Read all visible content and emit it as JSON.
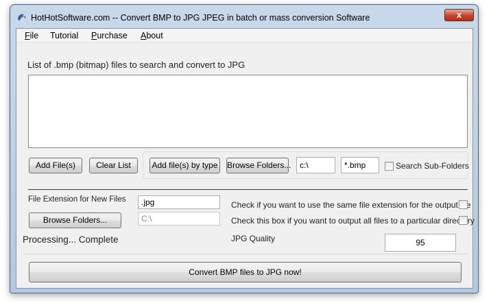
{
  "window": {
    "title": "HotHotSoftware.com -- Convert BMP to JPG JPEG in batch or mass conversion Software",
    "close_glyph": "x",
    "icon": "hothot-app-icon"
  },
  "menu": {
    "file": {
      "accel": "F",
      "rest": "ile"
    },
    "tutorial": "Tutorial",
    "purchase": {
      "accel": "P",
      "rest": "urchase"
    },
    "about": {
      "accel": "A",
      "rest": "bout"
    }
  },
  "list": {
    "label": "List of .bmp (bitmap) files to search and convert to JPG"
  },
  "buttons": {
    "add_files": "Add File(s)",
    "clear_list": "Clear List",
    "add_by_type": "Add file(s) by type",
    "browse_folders": "Browse Folders...",
    "browse_folders_output": "Browse Folders...",
    "convert": "Convert BMP files to JPG now!"
  },
  "search": {
    "folder_value": "c:\\",
    "pattern_value": "*.bmp",
    "subfolders_label": "Search Sub-Folders",
    "subfolders_checked": false
  },
  "output": {
    "extension_label": "File Extension for New Files",
    "extension_value": ".jpg",
    "directory_value": "C:\\",
    "same_ext_label": "Check if you want to use the same file extension for the output file",
    "same_ext_checked": false,
    "particular_dir_label": "Check this box if you want to output all files to a particular directory",
    "particular_dir_checked": false,
    "quality_label": "JPG Quality",
    "quality_value": "95"
  },
  "status": {
    "text": "Processing... Complete"
  }
}
